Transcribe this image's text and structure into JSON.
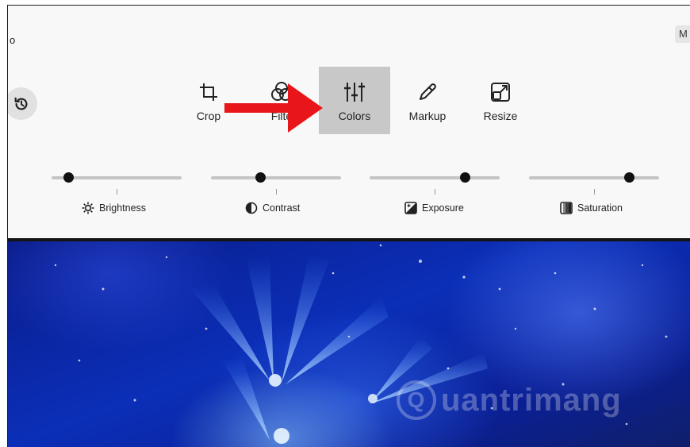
{
  "window": {
    "title_fragment": "o",
    "corner_button": "M"
  },
  "toolbar": {
    "tools": [
      {
        "label": "Crop",
        "icon": "crop-icon"
      },
      {
        "label": "Filte",
        "icon": "filter-icon"
      },
      {
        "label": "Colors",
        "icon": "sliders-icon",
        "active": true
      },
      {
        "label": "Markup",
        "icon": "pen-icon"
      },
      {
        "label": "Resize",
        "icon": "resize-icon"
      }
    ]
  },
  "adjustments": [
    {
      "label": "Brightness",
      "icon": "brightness-icon",
      "value": 0.13
    },
    {
      "label": "Contrast",
      "icon": "contrast-icon",
      "value": 0.38
    },
    {
      "label": "Exposure",
      "icon": "exposure-icon",
      "value": 0.73
    },
    {
      "label": "Saturation",
      "icon": "saturation-icon",
      "value": 0.77
    }
  ],
  "colors": {
    "accent_arrow": "#e8161b",
    "active_tool_bg": "#c8c8c8",
    "photo_base": "#0b2fb8"
  },
  "watermark": {
    "text": "uantrimang",
    "logo_letter": "Q"
  }
}
